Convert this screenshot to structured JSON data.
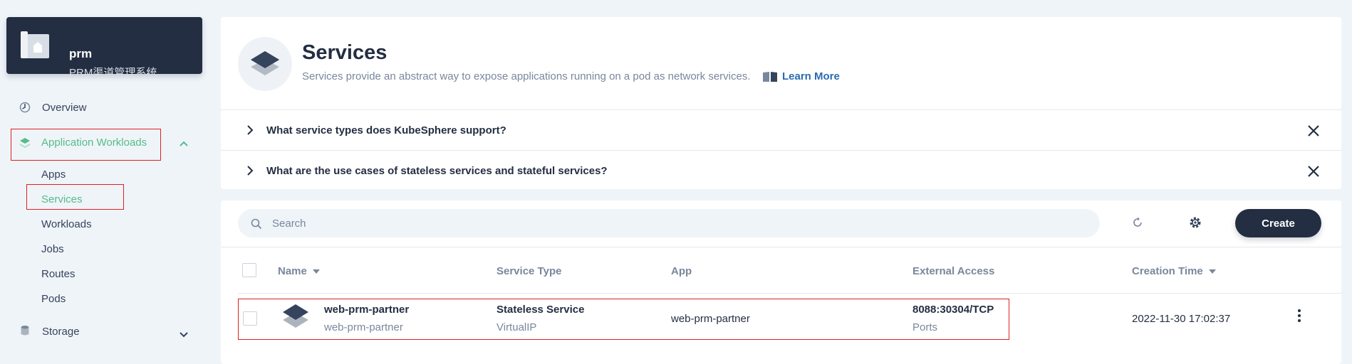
{
  "project": {
    "name": "prm",
    "description": "PRM渠道管理系统"
  },
  "sidebar": {
    "overview": "Overview",
    "app_workloads": "Application Workloads",
    "sub_items": [
      "Apps",
      "Services",
      "Workloads",
      "Jobs",
      "Routes",
      "Pods"
    ],
    "storage": "Storage"
  },
  "banner": {
    "title": "Services",
    "description": "Services provide an abstract way to expose applications running on a pod as network services.",
    "learn_more": "Learn More",
    "faq": [
      "What service types does KubeSphere support?",
      "What are the use cases of stateless services and stateful services?"
    ]
  },
  "toolbar": {
    "search_placeholder": "Search",
    "create_label": "Create"
  },
  "table": {
    "headers": {
      "name": "Name",
      "service_type": "Service Type",
      "app": "App",
      "external_access": "External Access",
      "creation_time": "Creation Time"
    },
    "rows": [
      {
        "name": "web-prm-partner",
        "name_sub": "web-prm-partner",
        "service_type": "Stateless Service",
        "service_type_sub": "VirtualIP",
        "app": "web-prm-partner",
        "external_access": "8088:30304/TCP",
        "external_access_sub": "Ports",
        "creation_time": "2022-11-30 17:02:37"
      }
    ]
  },
  "colors": {
    "accent_green": "#55bc8a",
    "dark": "#242e42",
    "highlight_red": "#e02020"
  }
}
